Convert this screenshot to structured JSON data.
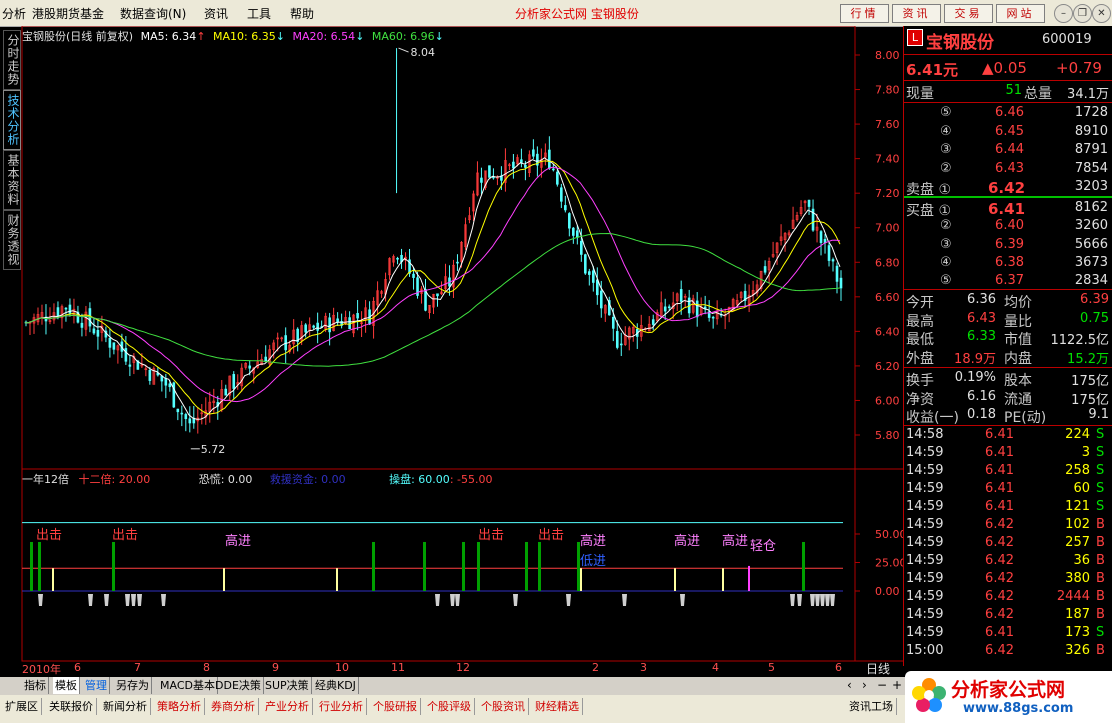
{
  "menu": {
    "items": [
      "分析",
      "港股期货基金",
      "数据查询(N)",
      "资讯",
      "工具",
      "帮助"
    ],
    "center_title": "分析家公式网  宝钢股份",
    "buttons": [
      "行情",
      "资讯",
      "交易",
      "网站"
    ]
  },
  "left_tabs": [
    "分时走势",
    "技术分析",
    "基本资料",
    "财务透视"
  ],
  "kline_header": {
    "name": "宝钢股份(日线 前复权)",
    "ma5": "MA5: 6.34",
    "ma10": "MA10: 6.35",
    "ma20": "MA20: 6.54",
    "ma60": "MA60: 6.96",
    "high_label": "8.04",
    "low_label": "5.72"
  },
  "price_axis": [
    "8.00",
    "7.80",
    "7.60",
    "7.40",
    "7.20",
    "7.00",
    "6.80",
    "6.60",
    "6.40",
    "6.20",
    "6.00",
    "5.80"
  ],
  "indicator_header": {
    "name": "一年12倍",
    "shier": "十二倍: 20.00",
    "konghuang": "恐慌: 0.00",
    "jiuyuan": "救援资金: 0.00",
    "caopan": "操盘: 60.00",
    "caopan2": ": -55.00"
  },
  "indicator_axis": [
    "50.00",
    "25.00",
    "0.00"
  ],
  "signals": [
    "出击",
    "出击",
    "高进",
    "出击",
    "出击",
    "高进",
    "低进",
    "高进",
    "高进",
    "轻仓"
  ],
  "x_axis": [
    "2010年",
    "6",
    "7",
    "8",
    "9",
    "10",
    "11",
    "12",
    "2",
    "3",
    "4",
    "5",
    "6"
  ],
  "quote": {
    "logo": "L",
    "name": "宝钢股份",
    "code": "600019",
    "price": "6.41元",
    "change": "▲0.05",
    "change_pct": "+0.79",
    "xianliang_label": "现量",
    "xianliang": "51",
    "zongliang_label": "总量",
    "zongliang": "34.1万",
    "sell": [
      {
        "level": "⑤",
        "price": "6.46",
        "vol": "1728"
      },
      {
        "level": "④",
        "price": "6.45",
        "vol": "8910"
      },
      {
        "level": "③",
        "price": "6.44",
        "vol": "8791"
      },
      {
        "level": "②",
        "price": "6.43",
        "vol": "7854"
      },
      {
        "level": "卖盘 ①",
        "price": "6.42",
        "vol": "3203"
      }
    ],
    "buy": [
      {
        "level": "买盘 ①",
        "price": "6.41",
        "vol": "8162"
      },
      {
        "level": "②",
        "price": "6.40",
        "vol": "3260"
      },
      {
        "level": "③",
        "price": "6.39",
        "vol": "5666"
      },
      {
        "level": "④",
        "price": "6.38",
        "vol": "3673"
      },
      {
        "level": "⑤",
        "price": "6.37",
        "vol": "2834"
      }
    ],
    "stats1": [
      {
        "l1": "今开",
        "v1": "6.36",
        "l2": "均价",
        "v2": "6.39"
      },
      {
        "l1": "最高",
        "v1": "6.43",
        "l2": "量比",
        "v2": "0.75"
      },
      {
        "l1": "最低",
        "v1": "6.33",
        "l2": "市值",
        "v2": "1122.5亿"
      },
      {
        "l1": "外盘",
        "v1": "18.9万",
        "l2": "内盘",
        "v2": "15.2万"
      }
    ],
    "stats2": [
      {
        "l1": "换手",
        "v1": "0.19%",
        "l2": "股本",
        "v2": "175亿"
      },
      {
        "l1": "净资",
        "v1": "6.16",
        "l2": "流通",
        "v2": "175亿"
      },
      {
        "l1": "收益(一)",
        "v1": "0.18",
        "l2": "PE(动)",
        "v2": "9.1"
      }
    ],
    "ticks": [
      {
        "t": "14:58",
        "p": "6.41",
        "v": "224",
        "s": "S"
      },
      {
        "t": "14:59",
        "p": "6.41",
        "v": "3",
        "s": "S"
      },
      {
        "t": "14:59",
        "p": "6.41",
        "v": "258",
        "s": "S"
      },
      {
        "t": "14:59",
        "p": "6.41",
        "v": "60",
        "s": "S"
      },
      {
        "t": "14:59",
        "p": "6.41",
        "v": "121",
        "s": "S"
      },
      {
        "t": "14:59",
        "p": "6.42",
        "v": "102",
        "s": "B"
      },
      {
        "t": "14:59",
        "p": "6.42",
        "v": "257",
        "s": "B"
      },
      {
        "t": "14:59",
        "p": "6.42",
        "v": "36",
        "s": "B"
      },
      {
        "t": "14:59",
        "p": "6.42",
        "v": "380",
        "s": "B"
      },
      {
        "t": "14:59",
        "p": "6.42",
        "v": "2444",
        "s": "B"
      },
      {
        "t": "14:59",
        "p": "6.42",
        "v": "187",
        "s": "B"
      },
      {
        "t": "14:59",
        "p": "6.41",
        "v": "173",
        "s": "S"
      },
      {
        "t": "15:00",
        "p": "6.42",
        "v": "326",
        "s": "B"
      }
    ],
    "period": "日线"
  },
  "chart_tabs": [
    "指标",
    "模板",
    "管理",
    "另存为",
    "MACD基本",
    "DDE决策",
    "SUP决策",
    "经典KDJ"
  ],
  "bottom_tabs": [
    "扩展区",
    "关联报价",
    "新闻分析",
    "策略分析",
    "券商分析",
    "产业分析",
    "行业分析",
    "个股研报",
    "个股评级",
    "个股资讯",
    "财经精选"
  ],
  "bottom_right": "资讯工场",
  "brand": {
    "name": "分析家公式网",
    "url": "www.88gs.com"
  },
  "colors": {
    "up": "#ff3b3b",
    "down": "#54ffff",
    "ma5": "#ffffff",
    "ma10": "#ffff00",
    "ma20": "#ff40ff",
    "ma60": "#40e040",
    "grid": "#b00000"
  }
}
